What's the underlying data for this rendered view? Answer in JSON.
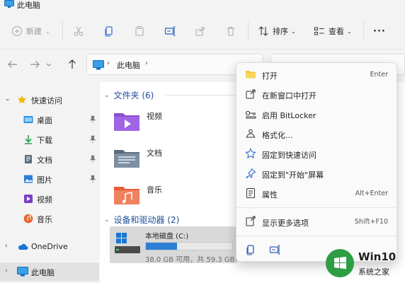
{
  "window": {
    "title": "此电脑"
  },
  "toolbar": {
    "new_label": "新建",
    "sort_label": "排序",
    "view_label": "查看",
    "more_label": "···"
  },
  "address": {
    "crumb": "此电脑"
  },
  "sidebar": {
    "items": [
      {
        "label": "快速访问"
      },
      {
        "label": "桌面"
      },
      {
        "label": "下载"
      },
      {
        "label": "文档"
      },
      {
        "label": "图片"
      },
      {
        "label": "视频"
      },
      {
        "label": "音乐"
      },
      {
        "label": "OneDrive"
      },
      {
        "label": "此电脑"
      }
    ]
  },
  "main": {
    "folders_header": "文件夹 (6)",
    "folders": [
      {
        "label": "视频"
      },
      {
        "label": "文档"
      },
      {
        "label": "音乐"
      }
    ],
    "drives_header": "设备和驱动器 (2)",
    "drive": {
      "name": "本地磁盘 (C:)",
      "free_text": "38.0 GB 可用，共 59.3 GB",
      "used_fraction": 0.36
    }
  },
  "context_menu": {
    "items": [
      {
        "label": "打开",
        "shortcut": "Enter"
      },
      {
        "label": "在新窗口中打开",
        "shortcut": ""
      },
      {
        "label": "启用 BitLocker",
        "shortcut": ""
      },
      {
        "label": "格式化...",
        "shortcut": ""
      },
      {
        "label": "固定到快速访问",
        "shortcut": ""
      },
      {
        "label": "固定到\"开始\"屏幕",
        "shortcut": ""
      },
      {
        "label": "属性",
        "shortcut": "Alt+Enter"
      },
      {
        "label": "显示更多选项",
        "shortcut": "Shift+F10"
      }
    ]
  },
  "watermark": {
    "line1": "Win10",
    "line2": "系统之家"
  },
  "colors": {
    "accent": "#2b7fd4",
    "folder_yellow": "#f4c542",
    "watermark_green": "#2e9e45"
  }
}
